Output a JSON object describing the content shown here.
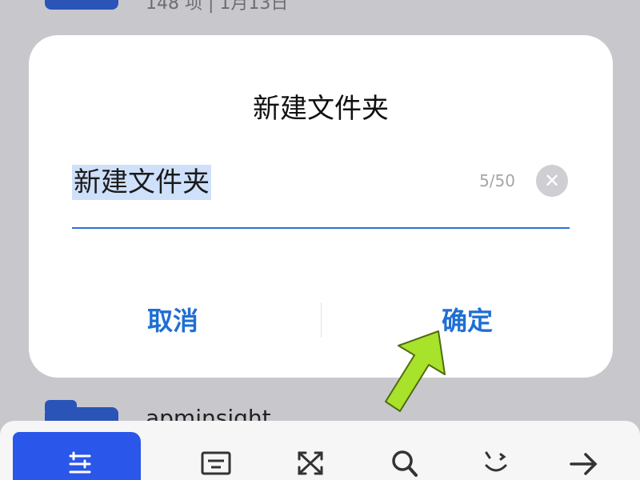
{
  "background": {
    "first_item_meta": "148 项 | 1月13日",
    "second_item_name": "apminsight"
  },
  "dialog": {
    "title": "新建文件夹",
    "input_value": "新建文件夹",
    "char_count": "5/50",
    "cancel_label": "取消",
    "confirm_label": "确定"
  },
  "toolbar": {
    "icons": [
      "list-icon",
      "keyboard-icon",
      "expand-icon",
      "search-icon",
      "emoji-icon",
      "arrow-right-icon"
    ]
  },
  "colors": {
    "accent": "#1f6fd3",
    "toolbar_active": "#2a56ea",
    "arrow": "#a8e22a"
  }
}
